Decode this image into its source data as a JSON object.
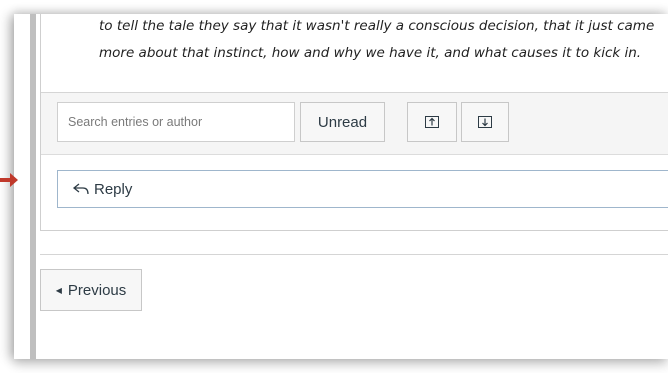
{
  "post": {
    "line1": "to tell the tale they say that it wasn't really a conscious decision, that it just came",
    "line2": "more about that instinct, how and why we have it, and what causes it to kick in."
  },
  "toolbar": {
    "search_placeholder": "Search entries or author",
    "unread_label": "Unread",
    "collapse_icon": "arrow-up-box-icon",
    "expand_icon": "arrow-down-box-icon"
  },
  "reply": {
    "label": "Reply",
    "icon": "reply-arrow-icon"
  },
  "pager": {
    "previous_label": "Previous"
  },
  "colors": {
    "pointer_arrow": "#c0392b",
    "reply_border": "#9fb6cc",
    "text": "#2d3b45"
  }
}
